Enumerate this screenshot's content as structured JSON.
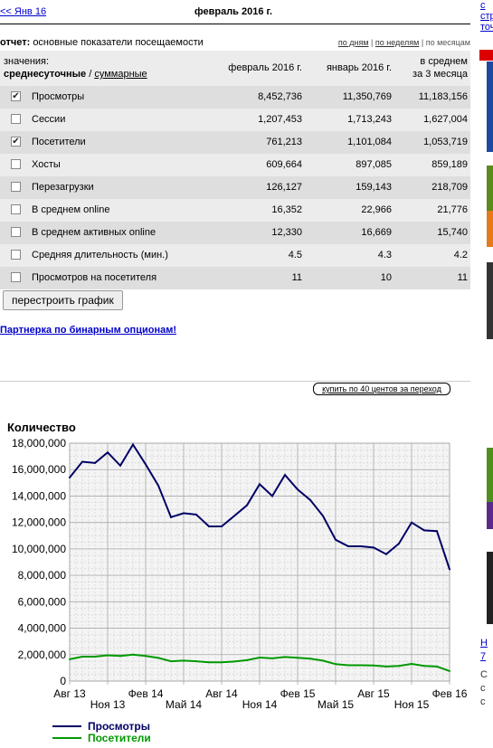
{
  "nav": {
    "prev_month": "<< Янв 16",
    "current_month": "февраль 2016 г."
  },
  "report": {
    "label": "отчет:",
    "name": "основные показатели посещаемости",
    "period_links": [
      "по дням",
      "по неделям",
      "по месяцам"
    ],
    "separator": "|"
  },
  "table": {
    "values_label": "значения:",
    "mode_daily": "среднесуточные",
    "mode_sep": "/",
    "mode_total": "суммарные",
    "col1": "февраль 2016 г.",
    "col2": "январь 2016 г.",
    "col3_line1": "в среднем",
    "col3_line2": "за 3 месяца",
    "rows": [
      {
        "label": "Просмотры",
        "checked": true,
        "v1": "8,452,736",
        "v2": "11,350,769",
        "v3": "11,183,156"
      },
      {
        "label": "Сессии",
        "checked": false,
        "v1": "1,207,453",
        "v2": "1,713,243",
        "v3": "1,627,004"
      },
      {
        "label": "Посетители",
        "checked": true,
        "v1": "761,213",
        "v2": "1,101,084",
        "v3": "1,053,719"
      },
      {
        "label": "Хосты",
        "checked": false,
        "v1": "609,664",
        "v2": "897,085",
        "v3": "859,189"
      },
      {
        "label": "Перезагрузки",
        "checked": false,
        "v1": "126,127",
        "v2": "159,143",
        "v3": "218,709"
      },
      {
        "label": "В среднем online",
        "checked": false,
        "v1": "16,352",
        "v2": "22,966",
        "v3": "21,776"
      },
      {
        "label": "В среднем активных online",
        "checked": false,
        "v1": "12,330",
        "v2": "16,669",
        "v3": "15,740"
      },
      {
        "label": "Средняя длительность (мин.)",
        "checked": false,
        "v1": "4.5",
        "v2": "4.3",
        "v3": "4.2"
      },
      {
        "label": "Просмотров на посетителя",
        "checked": false,
        "v1": "11",
        "v2": "10",
        "v3": "11"
      }
    ]
  },
  "buttons": {
    "rebuild": "перестроить график",
    "partner": "Партнерка по бинарным опционам!",
    "buy": "купить по 40 центов за переход"
  },
  "right_strip": {
    "text_top": [
      "с",
      "стр",
      "точ"
    ],
    "text_bottom": [
      "Н",
      "7",
      "С",
      "с",
      "с"
    ]
  },
  "colors": {
    "views": "#000066",
    "visitors": "#009900",
    "grid": "#cccccc",
    "plot_bg": "#f4f4f4",
    "row_odd": "#dedede",
    "row_even": "#ececec"
  },
  "chart_data": {
    "type": "line",
    "title": "Количество",
    "xlabel": "",
    "ylabel": "Количество",
    "ylim": [
      0,
      18000000
    ],
    "y_ticks": [
      "0",
      "2,000,000",
      "4,000,000",
      "6,000,000",
      "8,000,000",
      "10,000,000",
      "12,000,000",
      "14,000,000",
      "16,000,000",
      "18,000,000"
    ],
    "x_ticks": [
      "Авг 13",
      "Ноя 13",
      "Фев 14",
      "Май 14",
      "Авг 14",
      "Ноя 14",
      "Фев 15",
      "Май 15",
      "Авг 15",
      "Ноя 15",
      "Фев 16"
    ],
    "x": [
      "2013-08",
      "2013-09",
      "2013-10",
      "2013-11",
      "2013-12",
      "2014-01",
      "2014-02",
      "2014-03",
      "2014-04",
      "2014-05",
      "2014-06",
      "2014-07",
      "2014-08",
      "2014-09",
      "2014-10",
      "2014-11",
      "2014-12",
      "2015-01",
      "2015-02",
      "2015-03",
      "2015-04",
      "2015-05",
      "2015-06",
      "2015-07",
      "2015-08",
      "2015-09",
      "2015-10",
      "2015-11",
      "2015-12",
      "2016-01",
      "2016-02"
    ],
    "series": [
      {
        "name": "Просмотры",
        "values": [
          15400000,
          16600000,
          16500000,
          17300000,
          16300000,
          17900000,
          16400000,
          14800000,
          12400000,
          12700000,
          12600000,
          11700000,
          11700000,
          12500000,
          13300000,
          14900000,
          14000000,
          15600000,
          14500000,
          13700000,
          12500000,
          10700000,
          10200000,
          10200000,
          10100000,
          9600000,
          10400000,
          12000000,
          11400000,
          11350000,
          8450000
        ]
      },
      {
        "name": "Посетители",
        "values": [
          1650000,
          1850000,
          1850000,
          1950000,
          1900000,
          2000000,
          1900000,
          1750000,
          1500000,
          1550000,
          1500000,
          1420000,
          1420000,
          1480000,
          1580000,
          1780000,
          1720000,
          1820000,
          1760000,
          1700000,
          1550000,
          1280000,
          1200000,
          1200000,
          1180000,
          1100000,
          1150000,
          1300000,
          1150000,
          1100000,
          760000
        ]
      }
    ]
  }
}
